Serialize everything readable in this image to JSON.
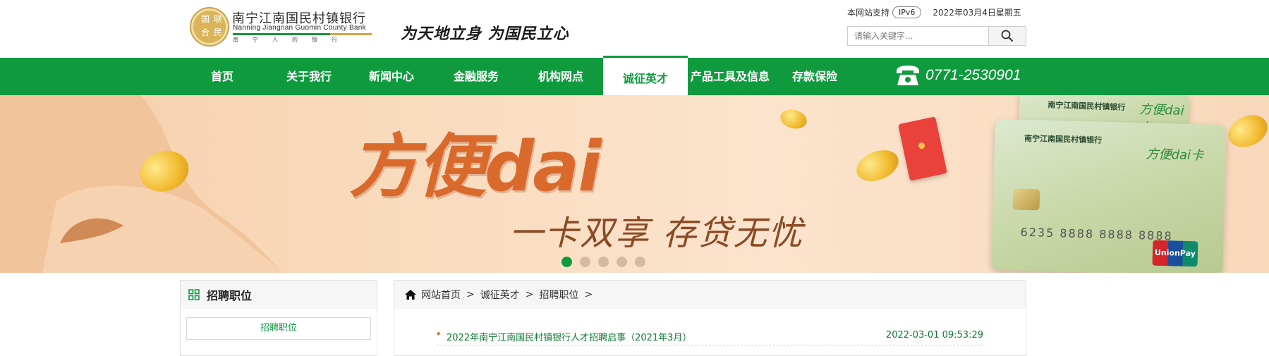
{
  "header": {
    "logo_cn": "南宁江南国民村镇银行",
    "logo_en": "Nanning Jiangnan Guomin County Bank",
    "logo_sub": "南宁人的银行",
    "logo_seal": [
      "国",
      "联",
      "合",
      "民"
    ],
    "slogan": "为天地立身 为国民立心",
    "support_text": "本网站支持",
    "ipv6": "IPv6",
    "date": "2022年03月4日星期五",
    "search_placeholder": "请输入关键字..."
  },
  "nav": {
    "items": [
      "首页",
      "关于我行",
      "新闻中心",
      "金融服务",
      "机构网点",
      "诚征英才",
      "产品工具及信息",
      "存款保险"
    ],
    "active_index": 5,
    "phone": "0771-2530901"
  },
  "banner": {
    "title": "方便dai",
    "subtitle": "一卡双享  存贷无忧",
    "card_bank": "南宁江南国民村镇银行",
    "card_product": "方便dai卡",
    "card_number": "6235 8888 8888 8888",
    "unionpay": "UnionPay",
    "slides": 5,
    "active_slide": 0
  },
  "sidebar": {
    "title": "招聘职位",
    "items": [
      "招聘职位"
    ]
  },
  "breadcrumb": {
    "items": [
      "网站首页",
      "诚征英才",
      "招聘职位"
    ],
    "separator": ">"
  },
  "list": [
    {
      "title": "2022年南宁江南国民村镇银行人才招聘启事（2021年3月）",
      "time": "2022-03-01 09:53:29"
    }
  ],
  "colors": {
    "brand_green": "#0f9b3d",
    "banner_orange": "#d96a2c"
  }
}
